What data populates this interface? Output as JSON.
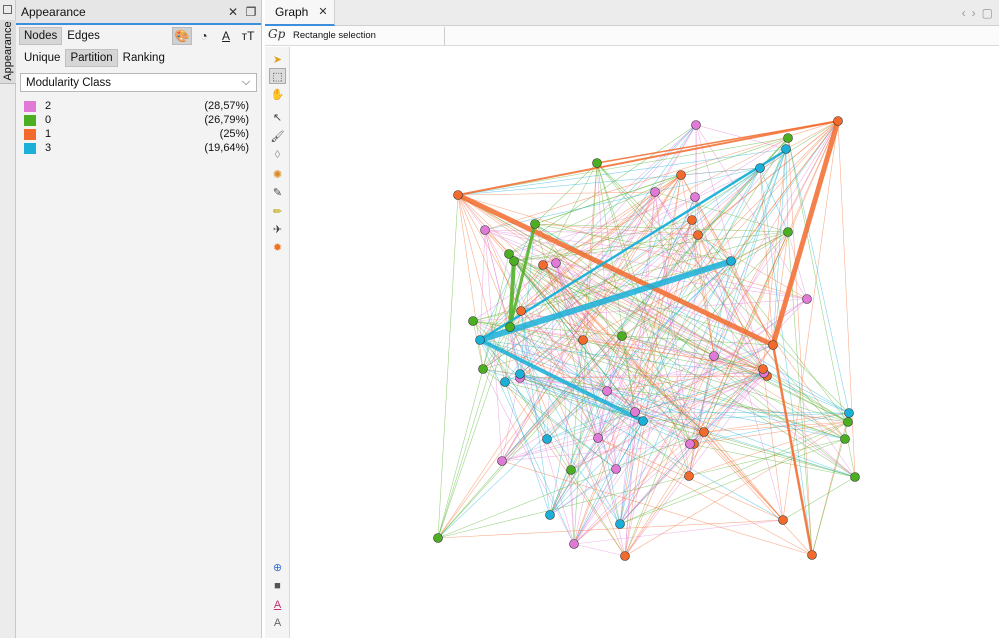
{
  "side_strip": {
    "tab_label": "Appearance"
  },
  "appearance": {
    "title": "Appearance",
    "mode_tabs": [
      "Nodes",
      "Edges"
    ],
    "sub_tabs": [
      "Unique",
      "Partition",
      "Ranking"
    ],
    "dropdown_value": "Modularity Class",
    "legend": [
      {
        "label": "2",
        "percent": "(28,57%)",
        "color": "#e07ad6"
      },
      {
        "label": "0",
        "percent": "(26,79%)",
        "color": "#4caf22"
      },
      {
        "label": "1",
        "percent": "(25%)",
        "color": "#f26b2d"
      },
      {
        "label": "3",
        "percent": "(19,64%)",
        "color": "#1ab0d8"
      }
    ]
  },
  "graph": {
    "tab_label": "Graph",
    "toolbar_text": "Rectangle selection"
  }
}
